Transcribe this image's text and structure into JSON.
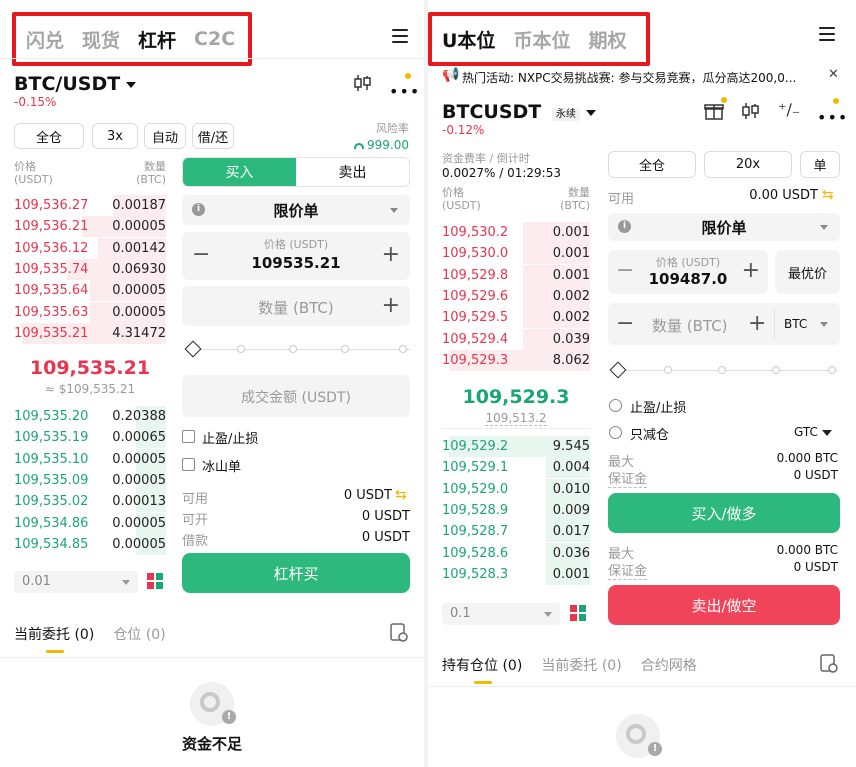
{
  "left": {
    "nav": [
      "闪兑",
      "现货",
      "杠杆",
      "C2C"
    ],
    "nav_active": 2,
    "pair": "BTC/USDT",
    "change": "-0.15%",
    "mode_buttons": [
      "全仓",
      "3x",
      "自动",
      "借/还"
    ],
    "risk_label": "风险率",
    "risk_value": "999.00",
    "price_header": "价格\n(USDT)",
    "qty_header": "数量\n(BTC)",
    "asks": [
      {
        "price": "109,536.27",
        "qty": "0.00187",
        "depth": 0.35
      },
      {
        "price": "109,536.21",
        "qty": "0.00005",
        "depth": 0.55
      },
      {
        "price": "109,536.12",
        "qty": "0.00142",
        "depth": 0.45
      },
      {
        "price": "109,535.74",
        "qty": "0.06930",
        "depth": 0.65
      },
      {
        "price": "109,535.64",
        "qty": "0.00005",
        "depth": 0.5
      },
      {
        "price": "109,535.63",
        "qty": "0.00005",
        "depth": 0.5
      },
      {
        "price": "109,535.21",
        "qty": "4.31472",
        "depth": 0.95
      }
    ],
    "mid_price": "109,535.21",
    "mid_usd": "≈ $109,535.21",
    "bids": [
      {
        "price": "109,535.20",
        "qty": "0.20388",
        "depth": 0.2
      },
      {
        "price": "109,535.19",
        "qty": "0.00065",
        "depth": 0.2
      },
      {
        "price": "109,535.10",
        "qty": "0.00005",
        "depth": 0.2
      },
      {
        "price": "109,535.09",
        "qty": "0.00005",
        "depth": 0.2
      },
      {
        "price": "109,535.02",
        "qty": "0.00013",
        "depth": 0.2
      },
      {
        "price": "109,534.86",
        "qty": "0.00005",
        "depth": 0.2
      },
      {
        "price": "109,534.85",
        "qty": "0.00005",
        "depth": 0.2
      }
    ],
    "precision": "0.01",
    "buy_tab": "买入",
    "sell_tab": "卖出",
    "order_type": "限价单",
    "price_label": "价格 (USDT)",
    "price_value": "109535.21",
    "qty_placeholder": "数量 (BTC)",
    "amount_placeholder": "成交金额 (USDT)",
    "tp_sl": "止盈/止损",
    "iceberg": "冰山单",
    "available_label": "可用",
    "available_value": "0 USDT",
    "can_open_label": "可开",
    "can_open_value": "0 USDT",
    "borrow_label": "借款",
    "borrow_value": "0 USDT",
    "action": "杠杆买",
    "tabs": [
      "当前委托 (0)",
      "仓位 (0)"
    ],
    "empty": "资金不足"
  },
  "right": {
    "nav": [
      "U本位",
      "币本位",
      "期权"
    ],
    "nav_active": 0,
    "announcement": "热门活动: NXPC交易挑战赛: 参与交易竞赛，瓜分高达200,0...",
    "pair": "BTCUSDT",
    "pair_tag": "永续",
    "change": "-0.12%",
    "funding_label": "资金费率 / 倒计时",
    "funding_value": "0.0027% / 01:29:53",
    "mode_buttons": [
      "全仓",
      "20x",
      "单"
    ],
    "available_label": "可用",
    "available_value": "0.00 USDT",
    "price_header": "价格\n(USDT)",
    "qty_header": "数量\n(BTC)",
    "asks": [
      {
        "price": "109,530.2",
        "qty": "0.001",
        "depth": 0.45
      },
      {
        "price": "109,530.0",
        "qty": "0.001",
        "depth": 0.45
      },
      {
        "price": "109,529.8",
        "qty": "0.001",
        "depth": 0.45
      },
      {
        "price": "109,529.6",
        "qty": "0.002",
        "depth": 0.45
      },
      {
        "price": "109,529.5",
        "qty": "0.002",
        "depth": 0.45
      },
      {
        "price": "109,529.4",
        "qty": "0.039",
        "depth": 0.45
      },
      {
        "price": "109,529.3",
        "qty": "8.062",
        "depth": 0.95
      }
    ],
    "mid_price": "109,529.3",
    "mark_price": "109,513.2",
    "bids": [
      {
        "price": "109,529.2",
        "qty": "9.545",
        "depth": 0.95
      },
      {
        "price": "109,529.1",
        "qty": "0.004",
        "depth": 0.3
      },
      {
        "price": "109,529.0",
        "qty": "0.010",
        "depth": 0.3
      },
      {
        "price": "109,528.9",
        "qty": "0.009",
        "depth": 0.3
      },
      {
        "price": "109,528.7",
        "qty": "0.017",
        "depth": 0.3
      },
      {
        "price": "109,528.6",
        "qty": "0.036",
        "depth": 0.3
      },
      {
        "price": "109,528.3",
        "qty": "0.001",
        "depth": 0.3
      }
    ],
    "precision": "0.1",
    "order_type": "限价单",
    "price_label": "价格 (USDT)",
    "price_value": "109487.0",
    "best_price": "最优价",
    "qty_placeholder": "数量 (BTC)",
    "qty_unit": "BTC",
    "tp_sl": "止盈/止损",
    "reduce_only": "只减仓",
    "tif": "GTC",
    "max_label": "最大",
    "max_value": "0.000 BTC",
    "margin_label": "保证金",
    "margin_value": "0 USDT",
    "buy_action": "买入/做多",
    "sell_max_label": "最大",
    "sell_max_value": "0.000 BTC",
    "sell_margin_label": "保证金",
    "sell_margin_value": "0 USDT",
    "sell_action": "卖出/做空",
    "tabs": [
      "持有仓位 (0)",
      "当前委托 (0)",
      "合约网格"
    ]
  },
  "colors": {
    "green": "#2db87d",
    "red": "#e8344e",
    "highlight": "#e8191e",
    "accent": "#f5b800"
  }
}
